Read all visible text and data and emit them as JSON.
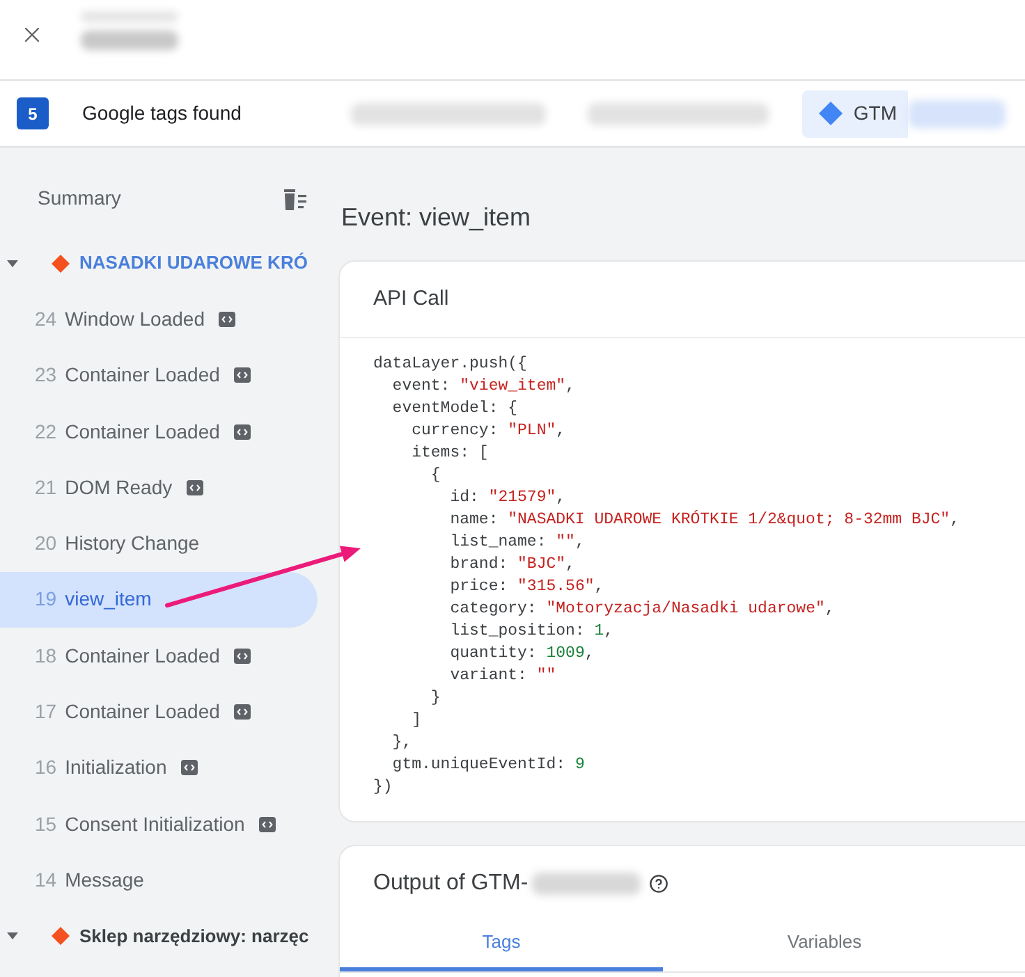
{
  "tag_bar": {
    "count": "5",
    "label": "Google tags found",
    "tabs": [
      {
        "label": "GTM",
        "selected": true
      }
    ]
  },
  "sidebar": {
    "title": "Summary",
    "groups": [
      {
        "label": "NASADKI UDAROWE KRÓ",
        "expanded": true,
        "events": [
          {
            "number": "24",
            "label": "Window Loaded",
            "tag_icon": true,
            "selected": false
          },
          {
            "number": "23",
            "label": "Container Loaded",
            "tag_icon": true,
            "selected": false
          },
          {
            "number": "22",
            "label": "Container Loaded",
            "tag_icon": true,
            "selected": false
          },
          {
            "number": "21",
            "label": "DOM Ready",
            "tag_icon": true,
            "selected": false
          },
          {
            "number": "20",
            "label": "History Change",
            "tag_icon": false,
            "selected": false
          },
          {
            "number": "19",
            "label": "view_item",
            "tag_icon": false,
            "selected": true
          },
          {
            "number": "18",
            "label": "Container Loaded",
            "tag_icon": true,
            "selected": false
          },
          {
            "number": "17",
            "label": "Container Loaded",
            "tag_icon": true,
            "selected": false
          },
          {
            "number": "16",
            "label": "Initialization",
            "tag_icon": true,
            "selected": false
          },
          {
            "number": "15",
            "label": "Consent Initialization",
            "tag_icon": true,
            "selected": false
          },
          {
            "number": "14",
            "label": "Message",
            "tag_icon": false,
            "selected": false
          }
        ]
      },
      {
        "label": "Sklep narzędziowy: narzęc",
        "expanded": true
      }
    ]
  },
  "event_panel": {
    "title": "Event: view_item",
    "api_call": {
      "title": "API Call",
      "code_lines": [
        [
          {
            "kind": "plain",
            "text": "dataLayer.push({"
          }
        ],
        [
          {
            "kind": "plain",
            "text": "  event: "
          },
          {
            "kind": "string",
            "text": "\"view_item\""
          },
          {
            "kind": "plain",
            "text": ","
          }
        ],
        [
          {
            "kind": "plain",
            "text": "  eventModel: {"
          }
        ],
        [
          {
            "kind": "plain",
            "text": "    currency: "
          },
          {
            "kind": "string",
            "text": "\"PLN\""
          },
          {
            "kind": "plain",
            "text": ","
          }
        ],
        [
          {
            "kind": "plain",
            "text": "    items: ["
          }
        ],
        [
          {
            "kind": "plain",
            "text": "      {"
          }
        ],
        [
          {
            "kind": "plain",
            "text": "        id: "
          },
          {
            "kind": "string",
            "text": "\"21579\""
          },
          {
            "kind": "plain",
            "text": ","
          }
        ],
        [
          {
            "kind": "plain",
            "text": "        name: "
          },
          {
            "kind": "string",
            "text": "\"NASADKI UDAROWE KRÓTKIE 1/2&quot; 8-32mm BJC\""
          },
          {
            "kind": "plain",
            "text": ","
          }
        ],
        [
          {
            "kind": "plain",
            "text": "        list_name: "
          },
          {
            "kind": "string",
            "text": "\"\""
          },
          {
            "kind": "plain",
            "text": ","
          }
        ],
        [
          {
            "kind": "plain",
            "text": "        brand: "
          },
          {
            "kind": "string",
            "text": "\"BJC\""
          },
          {
            "kind": "plain",
            "text": ","
          }
        ],
        [
          {
            "kind": "plain",
            "text": "        price: "
          },
          {
            "kind": "string",
            "text": "\"315.56\""
          },
          {
            "kind": "plain",
            "text": ","
          }
        ],
        [
          {
            "kind": "plain",
            "text": "        category: "
          },
          {
            "kind": "string",
            "text": "\"Motoryzacja/Nasadki udarowe\""
          },
          {
            "kind": "plain",
            "text": ","
          }
        ],
        [
          {
            "kind": "plain",
            "text": "        list_position: "
          },
          {
            "kind": "number",
            "text": "1"
          },
          {
            "kind": "plain",
            "text": ","
          }
        ],
        [
          {
            "kind": "plain",
            "text": "        quantity: "
          },
          {
            "kind": "number",
            "text": "1009"
          },
          {
            "kind": "plain",
            "text": ","
          }
        ],
        [
          {
            "kind": "plain",
            "text": "        variant: "
          },
          {
            "kind": "string",
            "text": "\"\""
          }
        ],
        [
          {
            "kind": "plain",
            "text": "      }"
          }
        ],
        [
          {
            "kind": "plain",
            "text": "    ]"
          }
        ],
        [
          {
            "kind": "plain",
            "text": "  },"
          }
        ],
        [
          {
            "kind": "plain",
            "text": "  gtm.uniqueEventId: "
          },
          {
            "kind": "number",
            "text": "9"
          }
        ],
        [
          {
            "kind": "plain",
            "text": "})"
          }
        ]
      ]
    },
    "output": {
      "title": "Output of GTM-",
      "tabs": [
        {
          "label": "Tags",
          "selected": true
        },
        {
          "label": "Variables",
          "selected": false
        }
      ]
    }
  }
}
